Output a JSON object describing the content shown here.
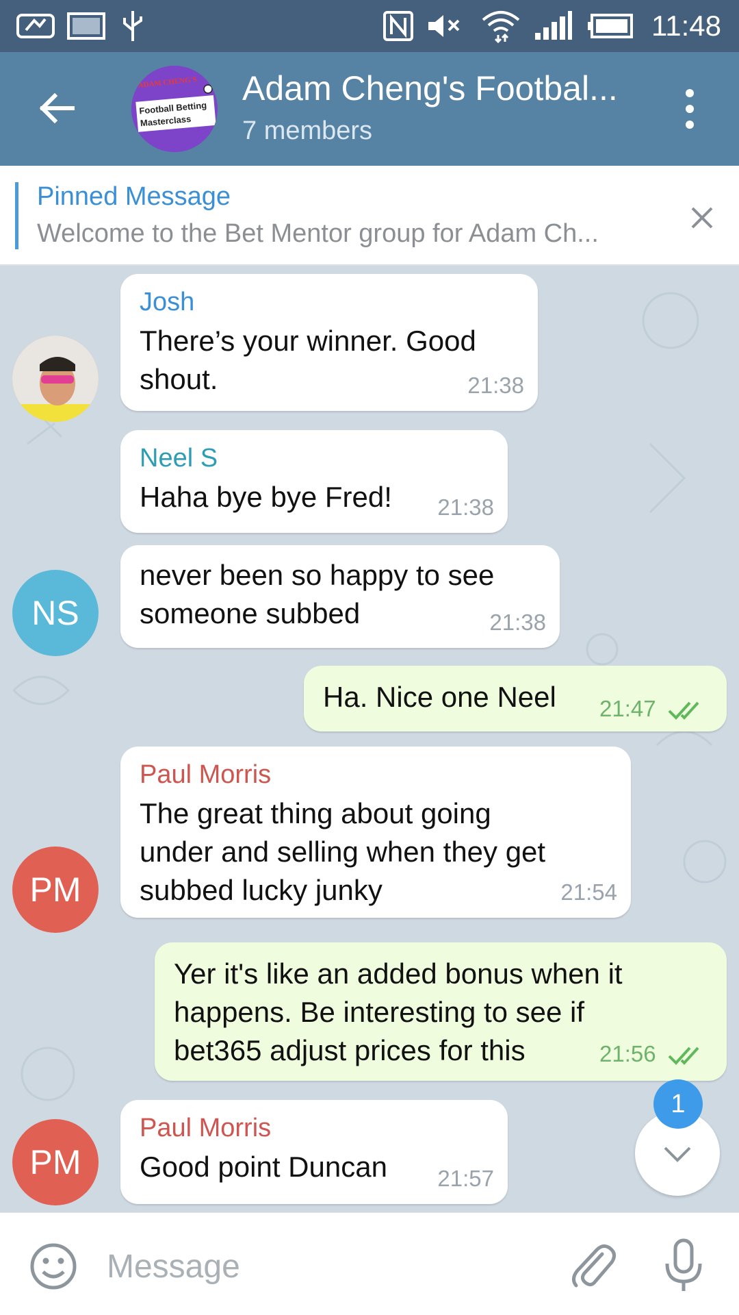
{
  "status_bar": {
    "time": "11:48"
  },
  "header": {
    "title": "Adam Cheng's Footbal...",
    "subtitle": "7 members",
    "avatar": {
      "top_text": "ADAM CHENG'S",
      "main_text_1": "Football Betting",
      "main_text_2": "Masterclass",
      "color": "#7d43c9"
    }
  },
  "pinned": {
    "label": "Pinned Message",
    "text": "Welcome to the Bet Mentor group for Adam Ch..."
  },
  "messages": [
    {
      "sender": "Josh",
      "text": "There’s your winner. Good\nshout.",
      "time": "21:38",
      "outgoing": false,
      "sender_color": "#3a8fd6"
    },
    {
      "sender": "Neel S",
      "text": "Haha bye bye Fred!",
      "time": "21:38",
      "outgoing": false,
      "sender_color": "#2d9db6"
    },
    {
      "text": "never been so happy to see\nsomeone subbed",
      "time": "21:38",
      "outgoing": false
    },
    {
      "text": "Ha. Nice one Neel",
      "time": "21:47",
      "outgoing": true
    },
    {
      "sender": "Paul Morris",
      "text": "The great thing about going\nunder and selling  when they get\nsubbed lucky junky",
      "time": "21:54",
      "outgoing": false,
      "sender_color": "#cf5650"
    },
    {
      "text": "Yer it's like an added bonus when it\nhappens. Be interesting to see if\nbet365 adjust prices for this",
      "time": "21:56",
      "outgoing": true
    },
    {
      "sender": "Paul Morris",
      "text": "Good point Duncan",
      "time": "21:57",
      "outgoing": false,
      "sender_color": "#cf5650"
    }
  ],
  "avatars": [
    {
      "initials": "",
      "color": "#c8a35a",
      "icon": "josh-photo"
    },
    {
      "initials": "NS",
      "color": "#5ab9d8"
    },
    {
      "initials": "PM",
      "color": "#e06153"
    },
    {
      "initials": "PM",
      "color": "#e06153"
    }
  ],
  "unread_count": "1",
  "input": {
    "placeholder": "Message"
  }
}
